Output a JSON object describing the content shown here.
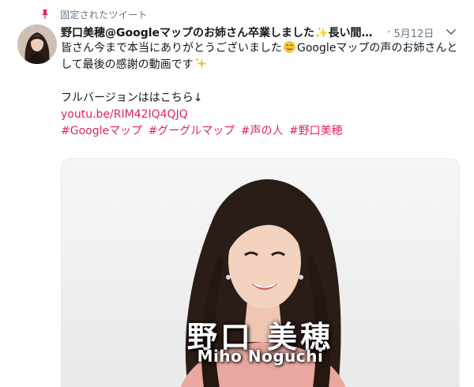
{
  "pinned": {
    "label": "固定されたツイート"
  },
  "tweet": {
    "display_name": "野口美穂@Googleマップのお姉さん卒業しました✨長い間あ…",
    "separator": "·",
    "timestamp": "5月12日",
    "body": {
      "line1": "皆さん今まで本当にありがとうございました",
      "line1_cont": "Googleマップの声のお姉さんと",
      "line2": "して最後の感謝の動画です",
      "line3": "フルバージョンははこちら↓",
      "link": "youtu.be/RIM42IQ4QJQ"
    },
    "hashtags": [
      "#Googleマップ",
      "#グーグルマップ",
      "#声の人",
      "#野口美穂"
    ]
  },
  "video": {
    "caption_jp": "野口 美穂",
    "caption_en": "Miho Noguchi"
  },
  "icons": {
    "pin": "pin-icon",
    "caret": "chevron-down-icon",
    "smile_emoji": "smiling-face-emoji",
    "sparkles_emoji": "sparkles-emoji"
  },
  "colors": {
    "link": "#e0245e",
    "muted": "#657786",
    "text": "#14171a"
  }
}
